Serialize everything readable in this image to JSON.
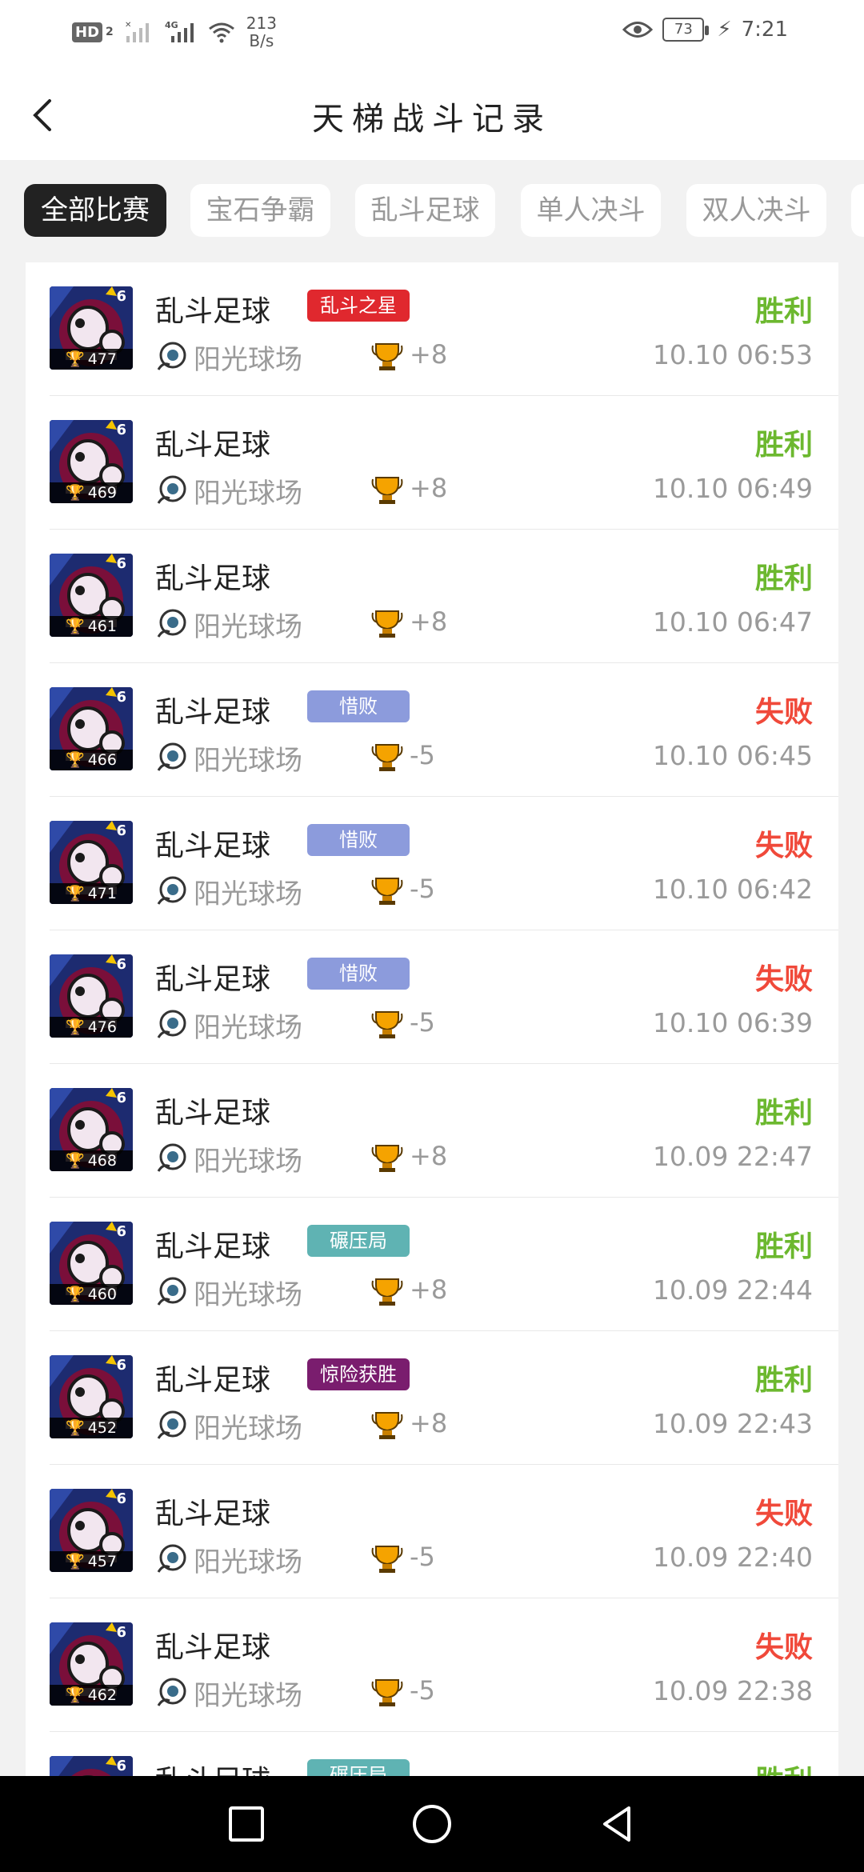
{
  "status_bar": {
    "network": "HD",
    "network_sub": "2",
    "signal_1": "4G",
    "speed_value": "213",
    "speed_unit": "B/s",
    "battery": "73",
    "time": "7:21"
  },
  "header": {
    "title": "天梯战斗记录"
  },
  "tabs": [
    {
      "label": "全部比赛",
      "active": true
    },
    {
      "label": "宝石争霸",
      "active": false
    },
    {
      "label": "乱斗足球",
      "active": false
    },
    {
      "label": "单人决斗",
      "active": false
    },
    {
      "label": "双人决斗",
      "active": false
    }
  ],
  "colors": {
    "win": "#6cb82f",
    "lose": "#f0493a",
    "badge_star": "#e0282e",
    "badge_narrow_loss": "#8c9bdc",
    "badge_crushing": "#5fb3b3",
    "badge_close_win": "#7a1d6e"
  },
  "matches": [
    {
      "mode": "乱斗足球",
      "badge": "乱斗之星",
      "badge_type": "star",
      "map": "阳光球场",
      "trophy_change": "+8",
      "trophies": "477",
      "level": "6",
      "result": "胜利",
      "result_type": "win",
      "time": "10.10 06:53"
    },
    {
      "mode": "乱斗足球",
      "badge": "",
      "badge_type": "",
      "map": "阳光球场",
      "trophy_change": "+8",
      "trophies": "469",
      "level": "6",
      "result": "胜利",
      "result_type": "win",
      "time": "10.10 06:49"
    },
    {
      "mode": "乱斗足球",
      "badge": "",
      "badge_type": "",
      "map": "阳光球场",
      "trophy_change": "+8",
      "trophies": "461",
      "level": "6",
      "result": "胜利",
      "result_type": "win",
      "time": "10.10 06:47"
    },
    {
      "mode": "乱斗足球",
      "badge": "惜败",
      "badge_type": "narrow_loss",
      "map": "阳光球场",
      "trophy_change": "-5",
      "trophies": "466",
      "level": "6",
      "result": "失败",
      "result_type": "lose",
      "time": "10.10 06:45"
    },
    {
      "mode": "乱斗足球",
      "badge": "惜败",
      "badge_type": "narrow_loss",
      "map": "阳光球场",
      "trophy_change": "-5",
      "trophies": "471",
      "level": "6",
      "result": "失败",
      "result_type": "lose",
      "time": "10.10 06:42"
    },
    {
      "mode": "乱斗足球",
      "badge": "惜败",
      "badge_type": "narrow_loss",
      "map": "阳光球场",
      "trophy_change": "-5",
      "trophies": "476",
      "level": "6",
      "result": "失败",
      "result_type": "lose",
      "time": "10.10 06:39"
    },
    {
      "mode": "乱斗足球",
      "badge": "",
      "badge_type": "",
      "map": "阳光球场",
      "trophy_change": "+8",
      "trophies": "468",
      "level": "6",
      "result": "胜利",
      "result_type": "win",
      "time": "10.09 22:47"
    },
    {
      "mode": "乱斗足球",
      "badge": "碾压局",
      "badge_type": "crushing",
      "map": "阳光球场",
      "trophy_change": "+8",
      "trophies": "460",
      "level": "6",
      "result": "胜利",
      "result_type": "win",
      "time": "10.09 22:44"
    },
    {
      "mode": "乱斗足球",
      "badge": "惊险获胜",
      "badge_type": "close_win",
      "map": "阳光球场",
      "trophy_change": "+8",
      "trophies": "452",
      "level": "6",
      "result": "胜利",
      "result_type": "win",
      "time": "10.09 22:43"
    },
    {
      "mode": "乱斗足球",
      "badge": "",
      "badge_type": "",
      "map": "阳光球场",
      "trophy_change": "-5",
      "trophies": "457",
      "level": "6",
      "result": "失败",
      "result_type": "lose",
      "time": "10.09 22:40"
    },
    {
      "mode": "乱斗足球",
      "badge": "",
      "badge_type": "",
      "map": "阳光球场",
      "trophy_change": "-5",
      "trophies": "462",
      "level": "6",
      "result": "失败",
      "result_type": "lose",
      "time": "10.09 22:38"
    },
    {
      "mode": "乱斗足球",
      "badge": "碾压局",
      "badge_type": "crushing",
      "map": "",
      "trophy_change": "",
      "trophies": "",
      "level": "6",
      "result": "胜利",
      "result_type": "win",
      "time": ""
    }
  ],
  "nav": {
    "recent": "square-icon",
    "home": "circle-icon",
    "back": "triangle-back-icon"
  }
}
